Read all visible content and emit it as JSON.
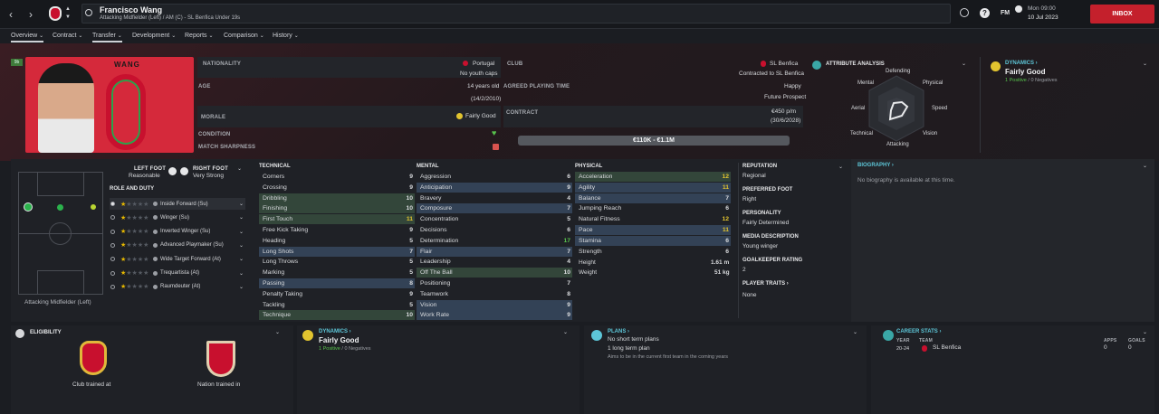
{
  "header": {
    "player_name": "Francisco Wang",
    "player_sub": "Attacking Midfielder (Left) / AM (C) - SL Benfica Under 19s",
    "time": "Mon 09:00",
    "date": "10 Jul 2023",
    "fm": "FM",
    "inbox": "INBOX",
    "help": "?"
  },
  "tabs": [
    "Overview",
    "Contract",
    "Transfer",
    "Development",
    "Reports",
    "Comparison",
    "History"
  ],
  "profile": {
    "badge": "9b",
    "shirt_name": "WANG",
    "shirt_number": "0"
  },
  "info": {
    "nationality_label": "NATIONALITY",
    "nationality": "Portugal",
    "youth_caps": "No youth caps",
    "club_label": "CLUB",
    "club": "SL Benfica",
    "club_contract": "Contracted to SL Benfica",
    "age_label": "AGE",
    "age": "14 years old",
    "dob": "(14/2/2010)",
    "playing_time_label": "AGREED PLAYING TIME",
    "playing_time": "Happy",
    "prospect": "Future Prospect",
    "morale_label": "MORALE",
    "morale": "Fairly Good",
    "contract_label": "CONTRACT",
    "wage": "€450 p/m",
    "expiry": "(30/6/2028)",
    "condition_label": "CONDITION",
    "sharpness_label": "MATCH SHARPNESS",
    "value_range": "€110K - €1.1M"
  },
  "attr_analysis": {
    "title": "ATTRIBUTE ANALYSIS",
    "labels": [
      "Defending",
      "Physical",
      "Speed",
      "Vision",
      "Attacking",
      "Technical",
      "Aerial",
      "Mental"
    ]
  },
  "dynamics": {
    "title": "DYNAMICS",
    "status": "Fairly Good",
    "positive": "1 Positive",
    "negative": "0 Negatives",
    "sep": "/"
  },
  "positions": {
    "label": "Attacking Midfielder (Left)"
  },
  "feet": {
    "left_label": "LEFT FOOT",
    "left": "Reasonable",
    "right_label": "RIGHT FOOT",
    "right": "Very Strong"
  },
  "roles": {
    "title": "ROLE AND DUTY",
    "items": [
      {
        "name": "Inside Forward (Su)",
        "stars": 1
      },
      {
        "name": "Winger (Su)",
        "stars": 1
      },
      {
        "name": "Inverted Winger (Su)",
        "stars": 1
      },
      {
        "name": "Advanced Playmaker (Su)",
        "stars": 1
      },
      {
        "name": "Wide Target Forward (At)",
        "stars": 1
      },
      {
        "name": "Trequartista (At)",
        "stars": 1
      },
      {
        "name": "Raumdeuter (At)",
        "stars": 1
      }
    ]
  },
  "technical": {
    "title": "TECHNICAL",
    "rows": [
      [
        "Corners",
        "9"
      ],
      [
        "Crossing",
        "9"
      ],
      [
        "Dribbling",
        "10"
      ],
      [
        "Finishing",
        "10"
      ],
      [
        "First Touch",
        "11"
      ],
      [
        "Free Kick Taking",
        "9"
      ],
      [
        "Heading",
        "5"
      ],
      [
        "Long Shots",
        "7"
      ],
      [
        "Long Throws",
        "5"
      ],
      [
        "Marking",
        "5"
      ],
      [
        "Passing",
        "8"
      ],
      [
        "Penalty Taking",
        "9"
      ],
      [
        "Tackling",
        "5"
      ],
      [
        "Technique",
        "10"
      ]
    ]
  },
  "mental": {
    "title": "MENTAL",
    "rows": [
      [
        "Aggression",
        "6"
      ],
      [
        "Anticipation",
        "9"
      ],
      [
        "Bravery",
        "4"
      ],
      [
        "Composure",
        "7"
      ],
      [
        "Concentration",
        "5"
      ],
      [
        "Decisions",
        "6"
      ],
      [
        "Determination",
        "17"
      ],
      [
        "Flair",
        "7"
      ],
      [
        "Leadership",
        "4"
      ],
      [
        "Off The Ball",
        "10"
      ],
      [
        "Positioning",
        "7"
      ],
      [
        "Teamwork",
        "8"
      ],
      [
        "Vision",
        "9"
      ],
      [
        "Work Rate",
        "9"
      ]
    ]
  },
  "physical": {
    "title": "PHYSICAL",
    "rows": [
      [
        "Acceleration",
        "12"
      ],
      [
        "Agility",
        "11"
      ],
      [
        "Balance",
        "7"
      ],
      [
        "Jumping Reach",
        "6"
      ],
      [
        "Natural Fitness",
        "12"
      ],
      [
        "Pace",
        "11"
      ],
      [
        "Stamina",
        "6"
      ],
      [
        "Strength",
        "6"
      ]
    ],
    "height_label": "Height",
    "height": "1.61 m",
    "weight_label": "Weight",
    "weight": "51 kg"
  },
  "details": {
    "reputation_label": "REPUTATION",
    "reputation": "Regional",
    "pref_foot_label": "PREFERRED FOOT",
    "pref_foot": "Right",
    "personality_label": "PERSONALITY",
    "personality": "Fairly Determined",
    "media_label": "MEDIA DESCRIPTION",
    "media": "Young winger",
    "gk_label": "GOALKEEPER RATING",
    "gk": "2",
    "traits_label": "PLAYER TRAITS",
    "traits": "None"
  },
  "biography": {
    "title": "BIOGRAPHY",
    "text": "No biography is available at this time."
  },
  "eligibility": {
    "title": "ELIGIBILITY",
    "club": "Club trained at",
    "nation": "Nation trained in"
  },
  "plans": {
    "title": "PLANS",
    "short": "No short term plans",
    "long": "1 long term plan",
    "desc": "Aims to be in the current first team in the coming years"
  },
  "career": {
    "title": "CAREER STATS",
    "year_label": "YEAR",
    "team_label": "TEAM",
    "apps_label": "APPS",
    "goals_label": "GOALS",
    "year": "20-24",
    "team": "SL Benfica",
    "apps": "0",
    "goals": "0"
  }
}
